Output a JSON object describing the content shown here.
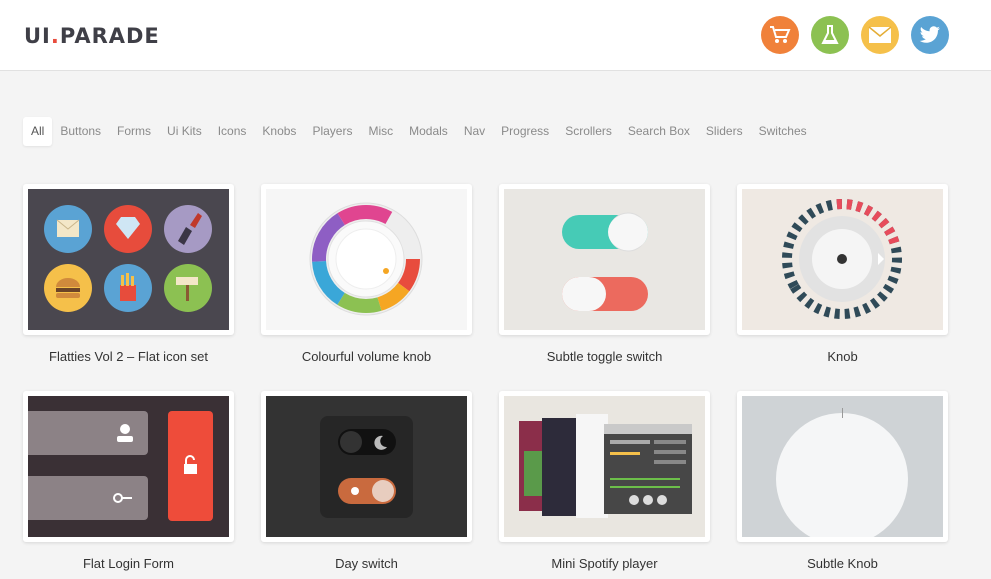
{
  "brand": {
    "logo_left": "UI",
    "logo_dot": ".",
    "logo_right": "PARADE"
  },
  "header_icons": [
    {
      "name": "cart-icon",
      "color": "#f0813a"
    },
    {
      "name": "flask-icon",
      "color": "#8cc152"
    },
    {
      "name": "mail-icon",
      "color": "#f5c04a"
    },
    {
      "name": "twitter-icon",
      "color": "#5aa3d4"
    }
  ],
  "filters": [
    "All",
    "Buttons",
    "Forms",
    "Ui Kits",
    "Icons",
    "Knobs",
    "Players",
    "Misc",
    "Modals",
    "Nav",
    "Progress",
    "Scrollers",
    "Search Box",
    "Sliders",
    "Switches"
  ],
  "active_filter": "All",
  "cards": [
    {
      "title": "Flatties Vol 2 – Flat icon set",
      "thumb": "flat-icon-set-thumbnail"
    },
    {
      "title": "Colourful volume knob",
      "thumb": "volume-knob-thumbnail"
    },
    {
      "title": "Subtle toggle switch",
      "thumb": "toggle-switch-thumbnail"
    },
    {
      "title": "Knob",
      "thumb": "knob-thumbnail"
    },
    {
      "title": "Flat Login Form",
      "thumb": "login-form-thumbnail"
    },
    {
      "title": "Day switch",
      "thumb": "day-switch-thumbnail"
    },
    {
      "title": "Mini Spotify player",
      "thumb": "spotify-player-thumbnail"
    },
    {
      "title": "Subtle Knob",
      "thumb": "subtle-knob-thumbnail"
    }
  ]
}
